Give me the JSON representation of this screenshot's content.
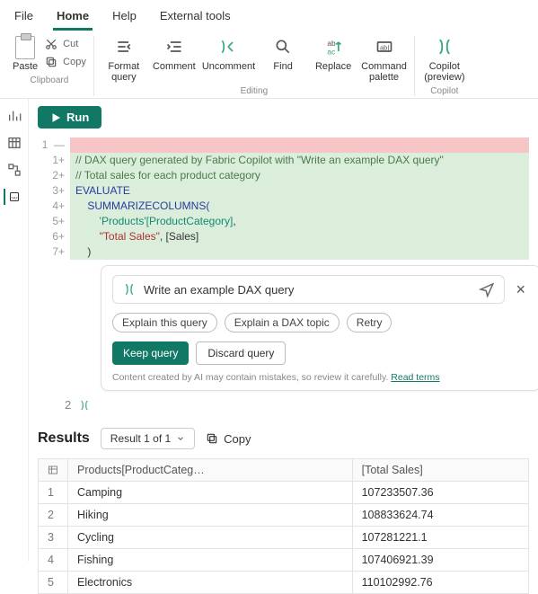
{
  "menu": {
    "file": "File",
    "home": "Home",
    "help": "Help",
    "external": "External tools"
  },
  "ribbon": {
    "paste": "Paste",
    "cut": "Cut",
    "copy": "Copy",
    "clipboard": "Clipboard",
    "format": "Format\nquery",
    "comment": "Comment",
    "uncomment": "Uncomment",
    "find": "Find",
    "replace": "Replace",
    "cmdpal": "Command\npalette",
    "editing": "Editing",
    "copilot": "Copilot\n(preview)",
    "copilot_grp": "Copilot"
  },
  "run": "Run",
  "code": {
    "g1": "1",
    "g1p": "1+",
    "g2p": "2+",
    "g3p": "3+",
    "g4p": "4+",
    "g5p": "5+",
    "g6p": "6+",
    "g7p": "7+",
    "l1": "// DAX query generated by Fabric Copilot with \"Write an example DAX query\"",
    "l2": "// Total sales for each product category",
    "l3_kw": "EVALUATE",
    "l4_ind": "    ",
    "l4_fn": "SUMMARIZECOLUMNS(",
    "l5_ind": "        ",
    "l5_a": "'Products'[ProductCategory]",
    "l5_c": ",",
    "l6_ind": "        ",
    "l6_a": "\"Total Sales\"",
    "l6_c": ", [Sales]",
    "l7_ind": "    ",
    "l7_a": ")"
  },
  "copilot": {
    "prompt": "Write an example DAX query",
    "chip1": "Explain this query",
    "chip2": "Explain a DAX topic",
    "chip3": "Retry",
    "keep": "Keep query",
    "discard": "Discard query",
    "footer_pre": "Content created by AI may contain mistakes, so review it carefully. ",
    "footer_link": "Read terms"
  },
  "line2": "2",
  "results": {
    "title": "Results",
    "dropdown": "Result 1 of 1",
    "copy": "Copy",
    "col1": "Products[ProductCateg…",
    "col2": "[Total Sales]",
    "rows": [
      {
        "i": "1",
        "c": "Camping",
        "v": "107233507.36"
      },
      {
        "i": "2",
        "c": "Hiking",
        "v": "108833624.74"
      },
      {
        "i": "3",
        "c": "Cycling",
        "v": "107281221.1"
      },
      {
        "i": "4",
        "c": "Fishing",
        "v": "107406921.39"
      },
      {
        "i": "5",
        "c": "Electronics",
        "v": "110102992.76"
      }
    ]
  }
}
